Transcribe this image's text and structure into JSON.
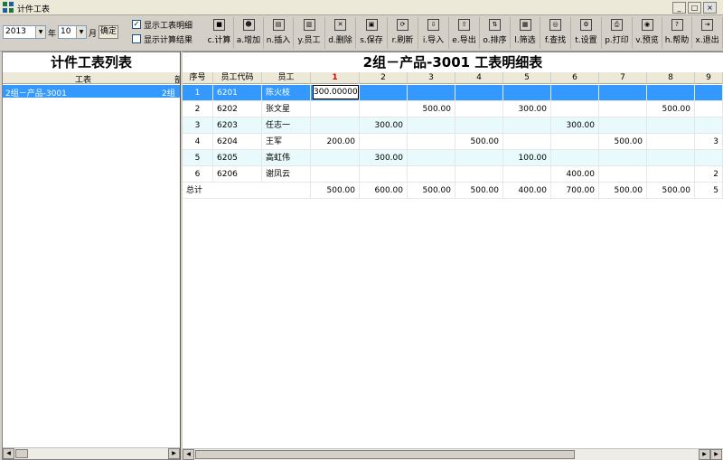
{
  "window": {
    "title": "计件工表",
    "minimize": "_",
    "maximize": "□",
    "close": "×"
  },
  "filters": {
    "year": "2013",
    "year_label": "年",
    "month": "10",
    "month_label": "月",
    "confirm": "确定",
    "show_detail": "显示工表明细",
    "show_detail_checked": true,
    "show_result": "显示计算结果",
    "show_result_checked": false
  },
  "toolbar": [
    {
      "key": "calc",
      "label": "c.计算"
    },
    {
      "key": "add",
      "label": "a.增加"
    },
    {
      "key": "insert",
      "label": "n.插入"
    },
    {
      "key": "employee",
      "label": "y.员工"
    },
    {
      "key": "delete",
      "label": "d.删除"
    },
    {
      "key": "save",
      "label": "s.保存"
    },
    {
      "key": "refresh",
      "label": "r.刷新"
    },
    {
      "key": "import",
      "label": "i.导入"
    },
    {
      "key": "export",
      "label": "e.导出"
    },
    {
      "key": "sort",
      "label": "o.排序"
    },
    {
      "key": "filter",
      "label": "l.筛选"
    },
    {
      "key": "find",
      "label": "f.查找"
    },
    {
      "key": "settings",
      "label": "t.设置"
    },
    {
      "key": "print",
      "label": "p.打印"
    },
    {
      "key": "preview",
      "label": "v.预览"
    },
    {
      "key": "help",
      "label": "h.帮助"
    },
    {
      "key": "exit",
      "label": "x.退出"
    }
  ],
  "left": {
    "title": "计件工表列表",
    "col_name": "工表",
    "col_dept": "部",
    "rows": [
      {
        "name": "2组－产品-3001",
        "dept": "2组"
      }
    ]
  },
  "right": {
    "title": "2组－产品-3001 工表明细表",
    "headers": [
      "序号",
      "员工代码",
      "员工",
      "1",
      "2",
      "3",
      "4",
      "5",
      "6",
      "7",
      "8",
      "9"
    ],
    "editing_value": "300.00000",
    "rows": [
      {
        "seq": "1",
        "code": "6201",
        "name": "陈火枝",
        "vals": [
          "",
          "",
          "",
          "",
          "",
          "",
          "",
          "",
          ""
        ]
      },
      {
        "seq": "2",
        "code": "6202",
        "name": "张文星",
        "vals": [
          "",
          "",
          "500.00",
          "",
          "300.00",
          "",
          "",
          "500.00",
          ""
        ]
      },
      {
        "seq": "3",
        "code": "6203",
        "name": "任志一",
        "vals": [
          "",
          "300.00",
          "",
          "",
          "",
          "300.00",
          "",
          "",
          ""
        ]
      },
      {
        "seq": "4",
        "code": "6204",
        "name": "王军",
        "vals": [
          "200.00",
          "",
          "",
          "500.00",
          "",
          "",
          "500.00",
          "",
          "3"
        ]
      },
      {
        "seq": "5",
        "code": "6205",
        "name": "高虹伟",
        "vals": [
          "",
          "300.00",
          "",
          "",
          "100.00",
          "",
          "",
          "",
          ""
        ]
      },
      {
        "seq": "6",
        "code": "6206",
        "name": "谢凤云",
        "vals": [
          "",
          "",
          "",
          "",
          "",
          "400.00",
          "",
          "",
          "2"
        ]
      }
    ],
    "total": {
      "label": "总计",
      "vals": [
        "500.00",
        "600.00",
        "500.00",
        "500.00",
        "400.00",
        "700.00",
        "500.00",
        "500.00",
        "5"
      ]
    }
  }
}
